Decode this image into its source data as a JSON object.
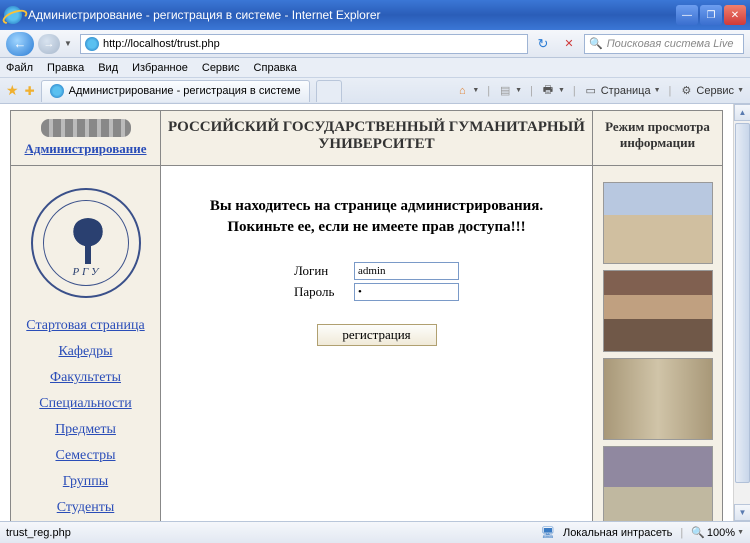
{
  "window": {
    "title": "Администрирование - регистрация в системе - Internet Explorer"
  },
  "address_bar": {
    "url": "http://localhost/trust.php"
  },
  "search": {
    "placeholder": "Поисковая система Live"
  },
  "menu": {
    "file": "Файл",
    "edit": "Правка",
    "view": "Вид",
    "favorites": "Избранное",
    "tools": "Сервис",
    "help": "Справка"
  },
  "tab": {
    "title": "Администрирование - регистрация в системе"
  },
  "toolbar": {
    "page": "Страница",
    "tools": "Сервис"
  },
  "page": {
    "header": {
      "admin_link": "Администрирование",
      "title": "РОССИЙСКИЙ ГОСУДАРСТВЕННЫЙ ГУМАНИТАРНЫЙ УНИВЕРСИТЕТ",
      "mode": "Режим просмотра информации"
    },
    "seal_text": "Р Г У",
    "nav": {
      "start": "Стартовая страница",
      "departments": "Кафедры",
      "faculties": "Факультеты",
      "specialties": "Специальности",
      "subjects": "Предметы",
      "semesters": "Семестры",
      "groups": "Группы",
      "students": "Студенты"
    },
    "main": {
      "line1": "Вы находитесь на странице администрирования.",
      "line2": "Покиньте ее, если не имеете прав доступа!!!",
      "login_label": "Логин",
      "login_value": "admin",
      "password_label": "Пароль",
      "password_value": "•",
      "submit": "регистрация"
    }
  },
  "status": {
    "left": "trust_reg.php",
    "zone": "Локальная интрасеть",
    "zoom": "100%"
  }
}
